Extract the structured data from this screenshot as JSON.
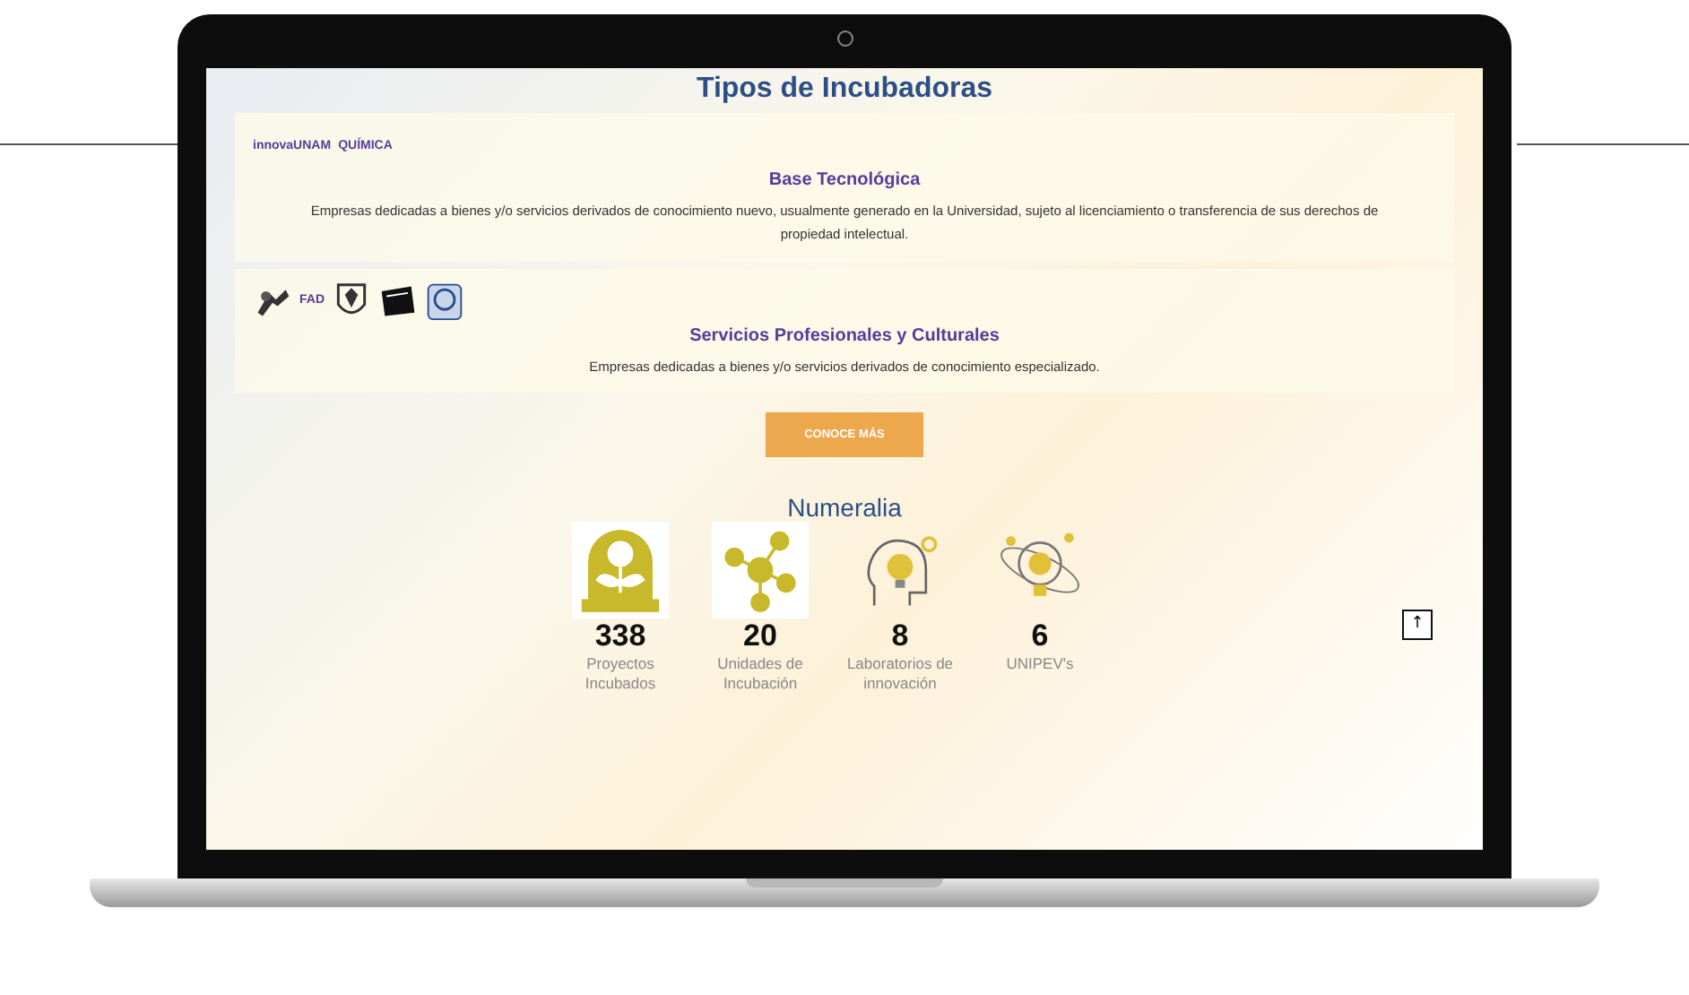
{
  "page": {
    "title": "Tipos de Incubadoras",
    "incubator_types": [
      {
        "logos": [
          {
            "kind": "text",
            "text": "innovaUNAM"
          },
          {
            "kind": "text",
            "text": "QUÍMICA"
          }
        ],
        "heading": "Base Tecnológica",
        "description": "Empresas dedicadas a bienes y/o servicios derivados de conocimiento nuevo, usualmente generado en la Universidad, sujeto al licenciamiento o transferencia de sus derechos de propiedad intelectual."
      },
      {
        "logos": [
          {
            "kind": "figure"
          },
          {
            "kind": "text",
            "text": "FAD"
          },
          {
            "kind": "shield"
          },
          {
            "kind": "folder"
          },
          {
            "kind": "seal"
          }
        ],
        "heading": "Servicios Profesionales y Culturales",
        "description": "Empresas dedicadas a bienes y/o servicios derivados de conocimiento especializado."
      }
    ],
    "cta_button": "CONOCE MÁS",
    "stats_title": "Numeralia",
    "stats": [
      {
        "kind": "plant",
        "value": "338",
        "label": "Proyectos Incubados"
      },
      {
        "kind": "network",
        "value": "20",
        "label": "Unidades de Incubación"
      },
      {
        "kind": "head",
        "value": "8",
        "label": "Laboratorios de innovación"
      },
      {
        "kind": "bulb",
        "value": "6",
        "label": "UNIPEV's"
      }
    ],
    "back_to_top": "↑"
  }
}
